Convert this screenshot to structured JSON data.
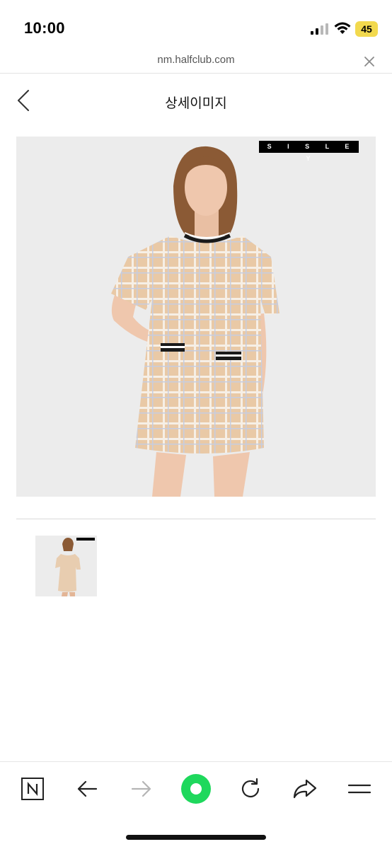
{
  "status_bar": {
    "time": "10:00",
    "battery": "45",
    "icons": [
      "signal-icon",
      "wifi-icon",
      "battery-icon"
    ]
  },
  "browser": {
    "url": "nm.halfclub.com"
  },
  "header": {
    "title": "상세이미지"
  },
  "product": {
    "brand_tag": "S I S L E Y"
  },
  "toolbar": {
    "icons": [
      "naver-home-icon",
      "back-arrow-icon",
      "forward-arrow-icon",
      "green-dot-icon",
      "refresh-icon",
      "share-icon",
      "menu-icon"
    ]
  },
  "colors": {
    "accent_green": "#1ed85c",
    "battery_yellow": "#f2d94e",
    "background": "#ffffff"
  }
}
